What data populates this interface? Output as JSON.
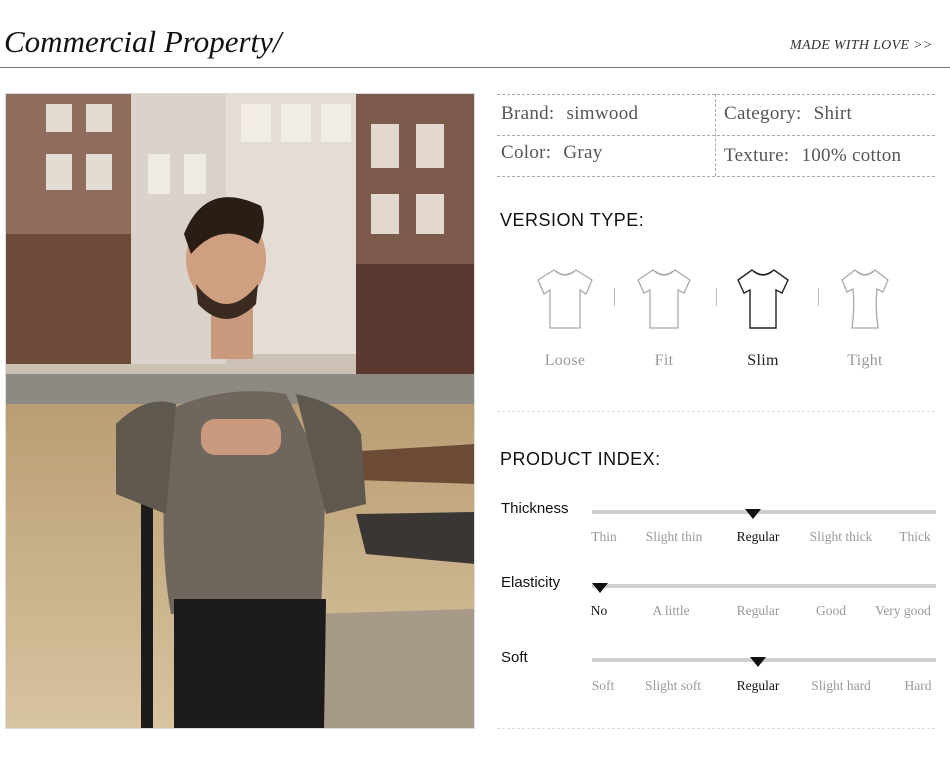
{
  "header": {
    "title": "Commercial Property/",
    "tagline": "MADE WITH LOVE >>"
  },
  "specs": {
    "brand_label": "Brand:",
    "brand_value": "simwood",
    "category_label": "Category:",
    "category_value": "Shirt",
    "color_label": "Color:",
    "color_value": "Gray",
    "texture_label": "Texture:",
    "texture_value": "100% cotton"
  },
  "version_type": {
    "title": "VERSION TYPE:",
    "options": [
      "Loose",
      "Fit",
      "Slim",
      "Tight"
    ],
    "selected": "Slim"
  },
  "product_index": {
    "title": "PRODUCT INDEX:",
    "thickness": {
      "label": "Thickness",
      "ticks": [
        "Thin",
        "Slight thin",
        "Regular",
        "Slight thick",
        "Thick"
      ],
      "selected": "Regular"
    },
    "elasticity": {
      "label": "Elasticity",
      "ticks": [
        "No",
        "A little",
        "Regular",
        "Good",
        "Very good"
      ],
      "selected": "No"
    },
    "soft": {
      "label": "Soft",
      "ticks": [
        "Soft",
        "Slight soft",
        "Regular",
        "Slight hard",
        "Hard"
      ],
      "selected": "Regular"
    }
  }
}
